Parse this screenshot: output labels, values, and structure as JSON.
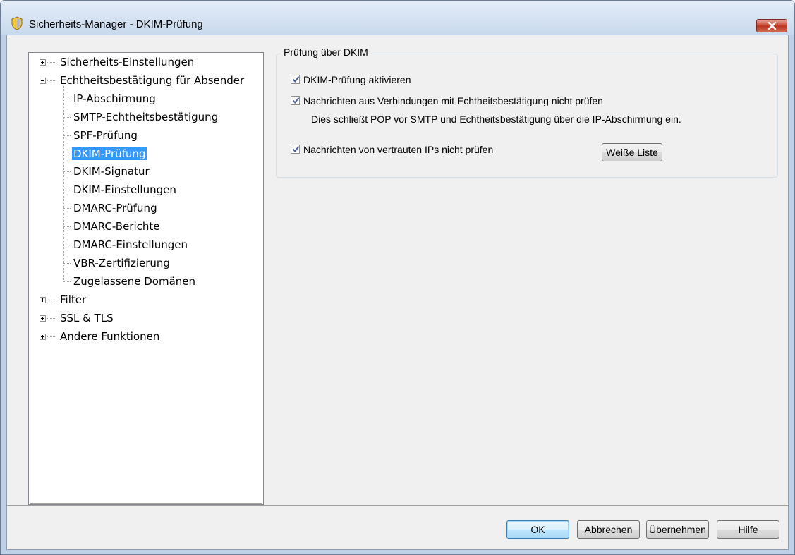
{
  "window": {
    "title": "Sicherheits-Manager - DKIM-Prüfung"
  },
  "tree": {
    "items": [
      {
        "label": "Sicherheits-Einstellungen",
        "level": 0,
        "expander": "plus"
      },
      {
        "label": "Echtheitsbestätigung für Absender",
        "level": 0,
        "expander": "minus"
      },
      {
        "label": "IP-Abschirmung",
        "level": 1
      },
      {
        "label": "SMTP-Echtheitsbestätigung",
        "level": 1
      },
      {
        "label": "SPF-Prüfung",
        "level": 1
      },
      {
        "label": "DKIM-Prüfung",
        "level": 1,
        "selected": true
      },
      {
        "label": "DKIM-Signatur",
        "level": 1
      },
      {
        "label": "DKIM-Einstellungen",
        "level": 1
      },
      {
        "label": "DMARC-Prüfung",
        "level": 1
      },
      {
        "label": "DMARC-Berichte",
        "level": 1
      },
      {
        "label": "DMARC-Einstellungen",
        "level": 1
      },
      {
        "label": "VBR-Zertifizierung",
        "level": 1
      },
      {
        "label": "Zugelassene Domänen",
        "level": 1
      },
      {
        "label": "Filter",
        "level": 0,
        "expander": "plus"
      },
      {
        "label": "SSL & TLS",
        "level": 0,
        "expander": "plus"
      },
      {
        "label": "Andere Funktionen",
        "level": 0,
        "expander": "plus"
      }
    ]
  },
  "group": {
    "title": "Prüfung über DKIM",
    "options": [
      {
        "label": "DKIM-Prüfung aktivieren",
        "checked": true
      },
      {
        "label": "Nachrichten aus Verbindungen mit Echtheitsbestätigung nicht prüfen",
        "checked": true
      },
      {
        "label": "Nachrichten von vertrauten IPs nicht prüfen",
        "checked": true
      }
    ],
    "info": "Dies schließt POP vor SMTP und Echtheitsbestätigung über die IP-Abschirmung ein.",
    "whitelist_button": "Weiße Liste"
  },
  "buttons": {
    "ok": "OK",
    "cancel": "Abbrechen",
    "apply": "Übernehmen",
    "help": "Hilfe"
  },
  "colors": {
    "selection": "#3399ff",
    "dialog_bg": "#f0f0f0",
    "close_button": "#c7442f"
  }
}
